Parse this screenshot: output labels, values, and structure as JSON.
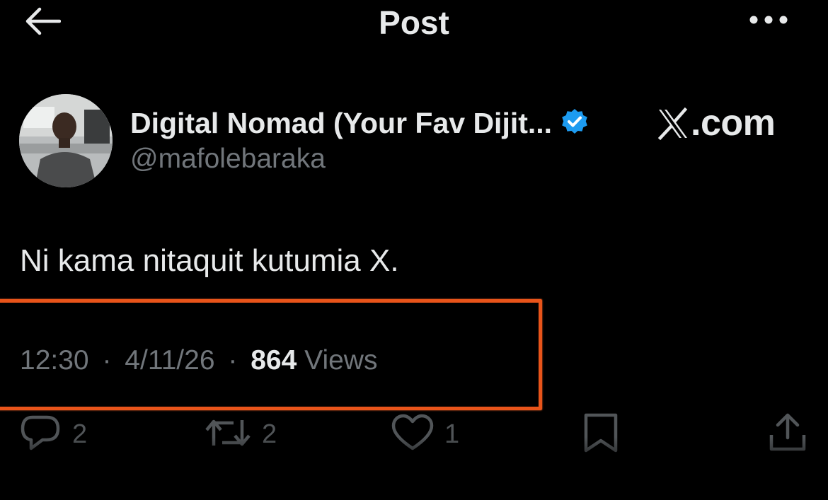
{
  "header": {
    "title": "Post"
  },
  "author": {
    "display_name": "Digital Nomad (Your Fav Dijit...",
    "handle": "@mafolebaraka",
    "verified": true
  },
  "brand": {
    "label": ".com"
  },
  "post": {
    "text": "Ni kama nitaquit kutumia X."
  },
  "meta": {
    "time": "12:30",
    "separator": "·",
    "date": "4/11/26",
    "views_count": "864",
    "views_label": "Views"
  },
  "actions": {
    "replies": "2",
    "reposts": "2",
    "likes": "1"
  },
  "colors": {
    "background": "#000000",
    "text_primary": "#e7e9ea",
    "text_secondary": "#71767b",
    "verified_blue": "#1d9bf0",
    "highlight_orange": "#e8541a"
  }
}
